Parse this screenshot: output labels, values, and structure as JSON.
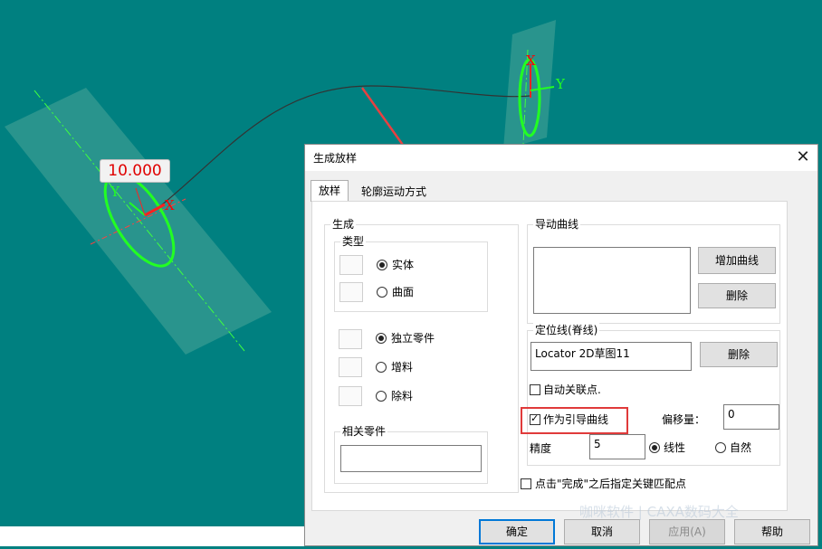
{
  "canvas": {
    "dimension_value": "10.000",
    "axis_x_left": "X",
    "axis_y_left": "Y",
    "axis_x_right": "X",
    "axis_y_right": "Y",
    "background_color": "#008080",
    "profile_color": "#00ff00",
    "arrow_color": "#e03a3a"
  },
  "dialog": {
    "title": "生成放样",
    "tabs": [
      "放样",
      "轮廓运动方式"
    ],
    "generate": {
      "label": "生成",
      "type_label": "类型",
      "type_options": [
        "实体",
        "曲面"
      ],
      "type_selected": "实体",
      "part_options": [
        "独立零件",
        "增料",
        "除料"
      ],
      "part_selected": "独立零件",
      "related_parts_label": "相关零件"
    },
    "guide_curves": {
      "label": "导动曲线",
      "add_button": "增加曲线",
      "delete_button": "删除"
    },
    "locator": {
      "label": "定位线(脊线)",
      "value": "Locator 2D草图11",
      "delete_button": "删除",
      "auto_link_label": "自动关联点.",
      "auto_link_checked": false,
      "as_guide_label": "作为引导曲线",
      "as_guide_checked": true,
      "offset_label": "偏移量：",
      "offset_value": "0",
      "precision_label": "精度",
      "precision_value": "5",
      "interp_options": [
        "线性",
        "自然"
      ],
      "interp_selected": "线性"
    },
    "match_after_finish_label": "点击\"完成\"之后指定关键匹配点",
    "buttons": {
      "ok": "确定",
      "cancel": "取消",
      "apply": "应用(A)",
      "help": "帮助"
    }
  },
  "watermark": "咖咪软件 | CAXA数码大全"
}
